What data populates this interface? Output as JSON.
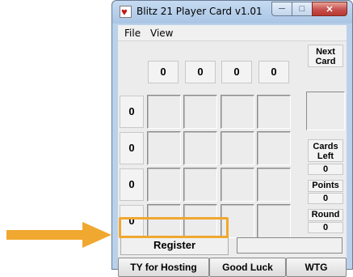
{
  "window": {
    "title": "Blitz 21 Player Card v1.01"
  },
  "menu": {
    "file": "File",
    "view": "View"
  },
  "columns": [
    "0",
    "0",
    "0",
    "0"
  ],
  "rows": [
    "0",
    "0",
    "0",
    "0"
  ],
  "side": {
    "next_card": "Next Card",
    "cards_left_label": "Cards Left",
    "cards_left_value": "0",
    "points_label": "Points",
    "points_value": "0",
    "round_label": "Round",
    "round_value": "0"
  },
  "register": {
    "label": "Register",
    "field_value": ""
  },
  "buttons": {
    "ty_hosting": "TY for Hosting",
    "good_luck": "Good Luck",
    "wtg": "WTG"
  },
  "colors": {
    "highlight": "#f0a830",
    "title_bar": "#b9d1ea",
    "close_button": "#c75050"
  }
}
